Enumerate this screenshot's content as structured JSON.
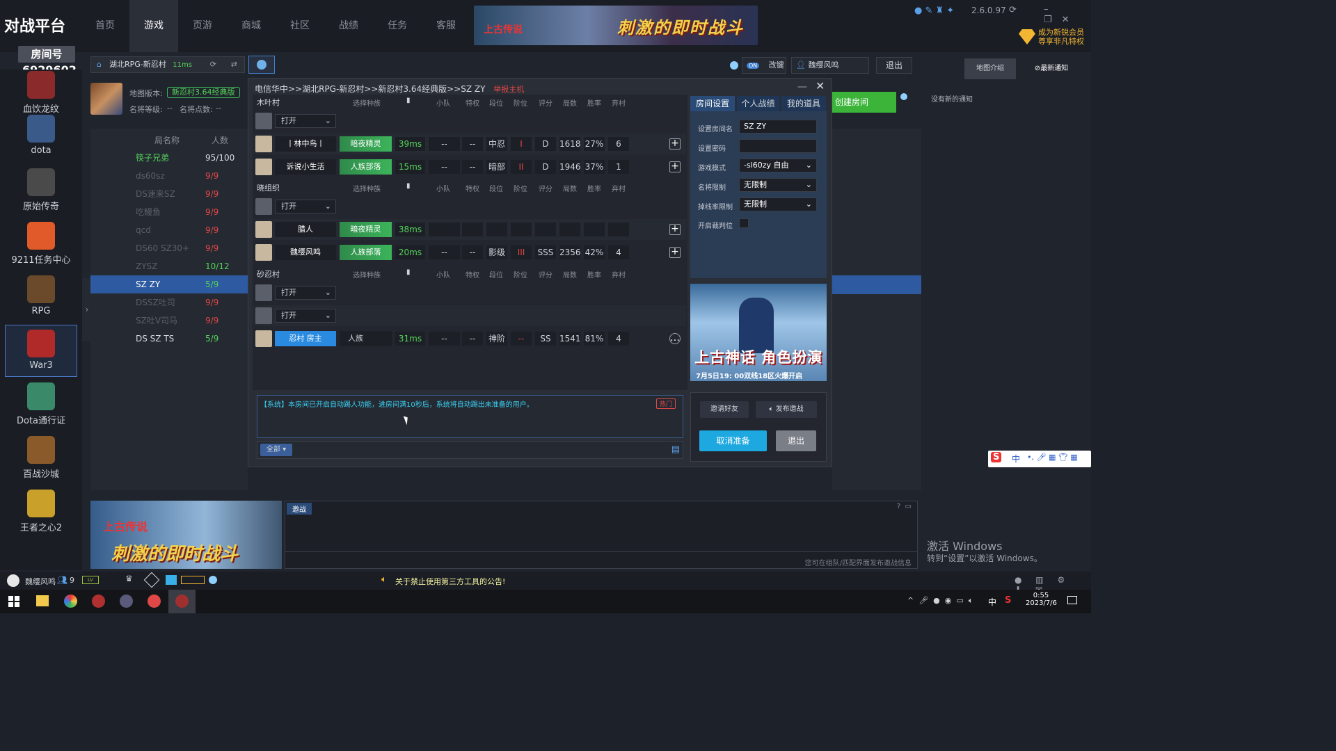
{
  "topbar": {
    "room_label": "房间号",
    "room_id": "6929602",
    "tabs": [
      "首页",
      "游戏",
      "页游",
      "商城",
      "社区",
      "战绩",
      "任务",
      "客服"
    ],
    "active_tab": "游戏",
    "banner_text": "刺激的即时战斗",
    "banner_brand": "上古传说",
    "version": "2.6.0.97",
    "vip_line1": "成为新锐会员",
    "vip_line2": "尊享非凡特权"
  },
  "leftnav": {
    "items": [
      {
        "label": "血饮龙纹",
        "icon": "blood-dragon-icon"
      },
      {
        "label": "dota",
        "icon": "dota-icon"
      },
      {
        "label": "原始传奇",
        "icon": "legend-icon"
      },
      {
        "label": "9211任务中心",
        "icon": "task-center-icon"
      },
      {
        "label": "RPG",
        "icon": "rpg-icon"
      },
      {
        "label": "War3",
        "icon": "war3-icon"
      },
      {
        "label": "Dota通行证",
        "icon": "pass-icon"
      },
      {
        "label": "百战沙城",
        "icon": "sand-city-icon"
      },
      {
        "label": "王者之心2",
        "icon": "king-heart-icon"
      }
    ],
    "selected": "War3"
  },
  "room": {
    "name": "湖北RPG-新忍村",
    "ping": "11ms",
    "map_version_label": "地图版本:",
    "map_version": "新忍村3.64经典版",
    "level_label": "名将等级:",
    "level_value": "--",
    "points_label": "名将点数:",
    "points_value": "--"
  },
  "lobby": {
    "col_name": "局名称",
    "col_count": "人数",
    "rows": [
      {
        "name": "筷子兄弟",
        "count": "95/100",
        "name_color": "#55d35a",
        "count_color": "#d8dbe0"
      },
      {
        "name": "ds60sz",
        "count": "9/9",
        "name_color": "#5a5f69",
        "count_color": "#e04848"
      },
      {
        "name": "DS速来SZ",
        "count": "9/9",
        "name_color": "#5a5f69",
        "count_color": "#e04848"
      },
      {
        "name": "吃鳗鱼",
        "count": "9/9",
        "name_color": "#5a5f69",
        "count_color": "#e04848"
      },
      {
        "name": "qcd",
        "count": "9/9",
        "name_color": "#5a5f69",
        "count_color": "#e04848"
      },
      {
        "name": "DS60 SZ30+",
        "count": "9/9",
        "name_color": "#5a5f69",
        "count_color": "#e04848"
      },
      {
        "name": "ZYSZ",
        "count": "10/12",
        "name_color": "#5a5f69",
        "count_color": "#55d35a"
      },
      {
        "name": "SZ ZY",
        "count": "5/9",
        "name_color": "#ffffff",
        "count_color": "#55d35a"
      },
      {
        "name": "DSSZ吐司",
        "count": "9/9",
        "name_color": "#5a5f69",
        "count_color": "#e04848"
      },
      {
        "name": "SZ吐V司马",
        "count": "9/9",
        "name_color": "#5a5f69",
        "count_color": "#e04848"
      },
      {
        "name": "DS SZ TS",
        "count": "5/9",
        "name_color": "#d8dbe0",
        "count_color": "#55d35a"
      }
    ]
  },
  "dialog": {
    "breadcrumb": "电信华中>>湖北RPG-新忍村>>新忍村3.64经典版>>SZ ZY",
    "report": "举报主机",
    "headers": [
      "选择种族",
      "小队",
      "特权",
      "段位",
      "阶位",
      "评分",
      "局数",
      "胜率",
      "弃村"
    ],
    "teams": [
      {
        "name": "木叶村",
        "slots": [
          {
            "type": "open",
            "label": "打开"
          },
          {
            "type": "player",
            "name": "丨林中鸟丨",
            "race": "暗夜精灵",
            "ping": "39ms",
            "team": "--",
            "priv": "--",
            "rank": "中忍",
            "tier": "I",
            "score": "D",
            "games": "1618",
            "win": "27%",
            "abandon": "6"
          },
          {
            "type": "player",
            "name": "诉说小生活",
            "race": "人族部落",
            "ping": "15ms",
            "team": "--",
            "priv": "--",
            "rank": "暗部",
            "tier": "II",
            "score": "D",
            "games": "1946",
            "win": "37%",
            "abandon": "1"
          }
        ]
      },
      {
        "name": "晓组织",
        "slots": [
          {
            "type": "open",
            "label": "打开"
          },
          {
            "type": "player",
            "name": "腊人",
            "race": "暗夜精灵",
            "ping": "38ms",
            "team": "",
            "priv": "",
            "rank": "",
            "tier": "",
            "score": "",
            "games": "",
            "win": "",
            "abandon": ""
          },
          {
            "type": "player",
            "name": "魏缨风鸣",
            "race": "人族部落",
            "ping": "20ms",
            "team": "--",
            "priv": "--",
            "rank": "影级",
            "tier": "III",
            "score": "SSS",
            "games": "2356",
            "win": "42%",
            "abandon": "4"
          }
        ]
      },
      {
        "name": "砂忍村",
        "slots": [
          {
            "type": "open",
            "label": "打开"
          },
          {
            "type": "open",
            "label": "打开"
          },
          {
            "type": "player",
            "name": "忍村 房主",
            "race": "人族",
            "ping": "31ms",
            "team": "--",
            "priv": "--",
            "rank": "神阶",
            "tier": "--",
            "score": "SS",
            "games": "1541",
            "win": "81%",
            "abandon": "4"
          }
        ]
      }
    ],
    "system_msg": "【系统】本房间已开启自动踢人功能，进房间满10秒后，系统将自动踢出未准备的用户。",
    "hot_badge": "热门",
    "chat_scope": "全部"
  },
  "settings": {
    "tabs": [
      "房间设置",
      "个人战绩",
      "我的道具"
    ],
    "room_name_label": "设置房间名",
    "room_name_value": "SZ ZY",
    "password_label": "设置密码",
    "mode_label": "游戏模式",
    "mode_value": "-sl60zy 自由",
    "general_label": "名将限制",
    "general_value": "无限制",
    "drop_label": "掉线率限制",
    "drop_value": "无限制",
    "judge_label": "开启裁判位",
    "create_room": "创建房间",
    "invite_friend": "邀请好友",
    "publish_invite": "发布邀战",
    "cancel_ready": "取消准备",
    "exit": "退出",
    "ad_title": "上古神话 角色扮演",
    "ad_sub": "7月5日19: 00双线18区火爆开启"
  },
  "header_right": {
    "toggle": "ON",
    "change_key": "改键",
    "user": "魏缨风鸣",
    "logout": "退出",
    "map_intro": "地图介绍",
    "latest_notice": "最新通知",
    "no_notice": "没有新的通知"
  },
  "bottom": {
    "invite_tab": "邀战",
    "invite_hint": "您可在组队/匹配界面发布邀战信息",
    "ad_text": "刺激的即时战斗",
    "ad_brand": "上古传说",
    "status_user": "魏缨风鸣",
    "status_count": "9",
    "announce": "关于禁止使用第三方工具的公告!",
    "watermark1": "激活 Windows",
    "watermark2": "转到“设置”以激活 Windows。",
    "clock_time": "0:55",
    "clock_date": "2023/7/6",
    "ime": "中"
  }
}
